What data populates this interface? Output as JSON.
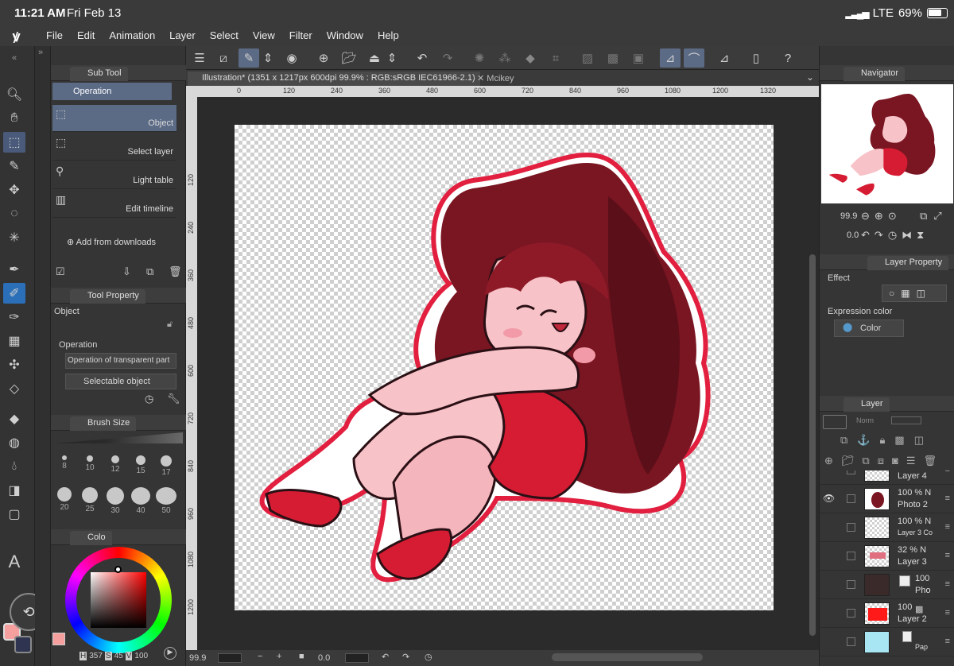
{
  "status": {
    "time": "11:21 AM",
    "date": "Fri Feb 13",
    "network": "LTE",
    "battery": "69%"
  },
  "menu": [
    "File",
    "Edit",
    "Animation",
    "Layer",
    "Select",
    "View",
    "Filter",
    "Window",
    "Help"
  ],
  "subtool": {
    "tab": "Sub Tool",
    "header": "Operation",
    "items": [
      "Object",
      "Select layer",
      "Light table",
      "Edit timeline"
    ],
    "add": "Add from downloads"
  },
  "toolprop": {
    "tab": "Tool Property",
    "title": "Object",
    "section": "Operation",
    "dropdown1": "Operation of transparent part",
    "dropdown2": "Selectable object"
  },
  "brushsize": {
    "tab": "Brush Size",
    "sizes": [
      "8",
      "10",
      "12",
      "15",
      "17",
      "20",
      "25",
      "30",
      "40",
      "50"
    ]
  },
  "color": {
    "tab": "Colo",
    "hsv_h": "357",
    "hsv_s": "45",
    "hsv_v": "100",
    "main": "#f59f9f",
    "sub": "#2f3550"
  },
  "doc": {
    "tab": "Illustration* (1351 x 1217px 600dpi 99.9% : RGB:sRGB IEC61966-2.1)",
    "tab2": "Mcikey"
  },
  "rulerH": [
    "0",
    "120",
    "240",
    "360",
    "480",
    "600",
    "720",
    "840",
    "960",
    "1080",
    "1200",
    "1320"
  ],
  "rulerV": [
    "120",
    "240",
    "360",
    "480",
    "600",
    "720",
    "840",
    "960",
    "1080",
    "1200"
  ],
  "bottom": {
    "zoom": "99.9",
    "angle": "0.0"
  },
  "navigator": {
    "tab": "Navigator",
    "zoom": "99.9",
    "angle": "0.0"
  },
  "layerprop": {
    "tab": "Layer Property",
    "effect": "Effect",
    "expr": "Expression color",
    "mode": "Color"
  },
  "layers": {
    "tab": "Layer",
    "blend": "Norm",
    "items": [
      {
        "op": "",
        "name": "Layer 4"
      },
      {
        "op": "100 % N",
        "name": "Photo 2"
      },
      {
        "op": "100 % N",
        "name": "Layer 3 Co"
      },
      {
        "op": "32 % N",
        "name": "Layer 3"
      },
      {
        "op": "100",
        "name": "Pho"
      },
      {
        "op": "100",
        "name": "Layer 2"
      },
      {
        "op": "",
        "name": "Pap"
      }
    ]
  }
}
